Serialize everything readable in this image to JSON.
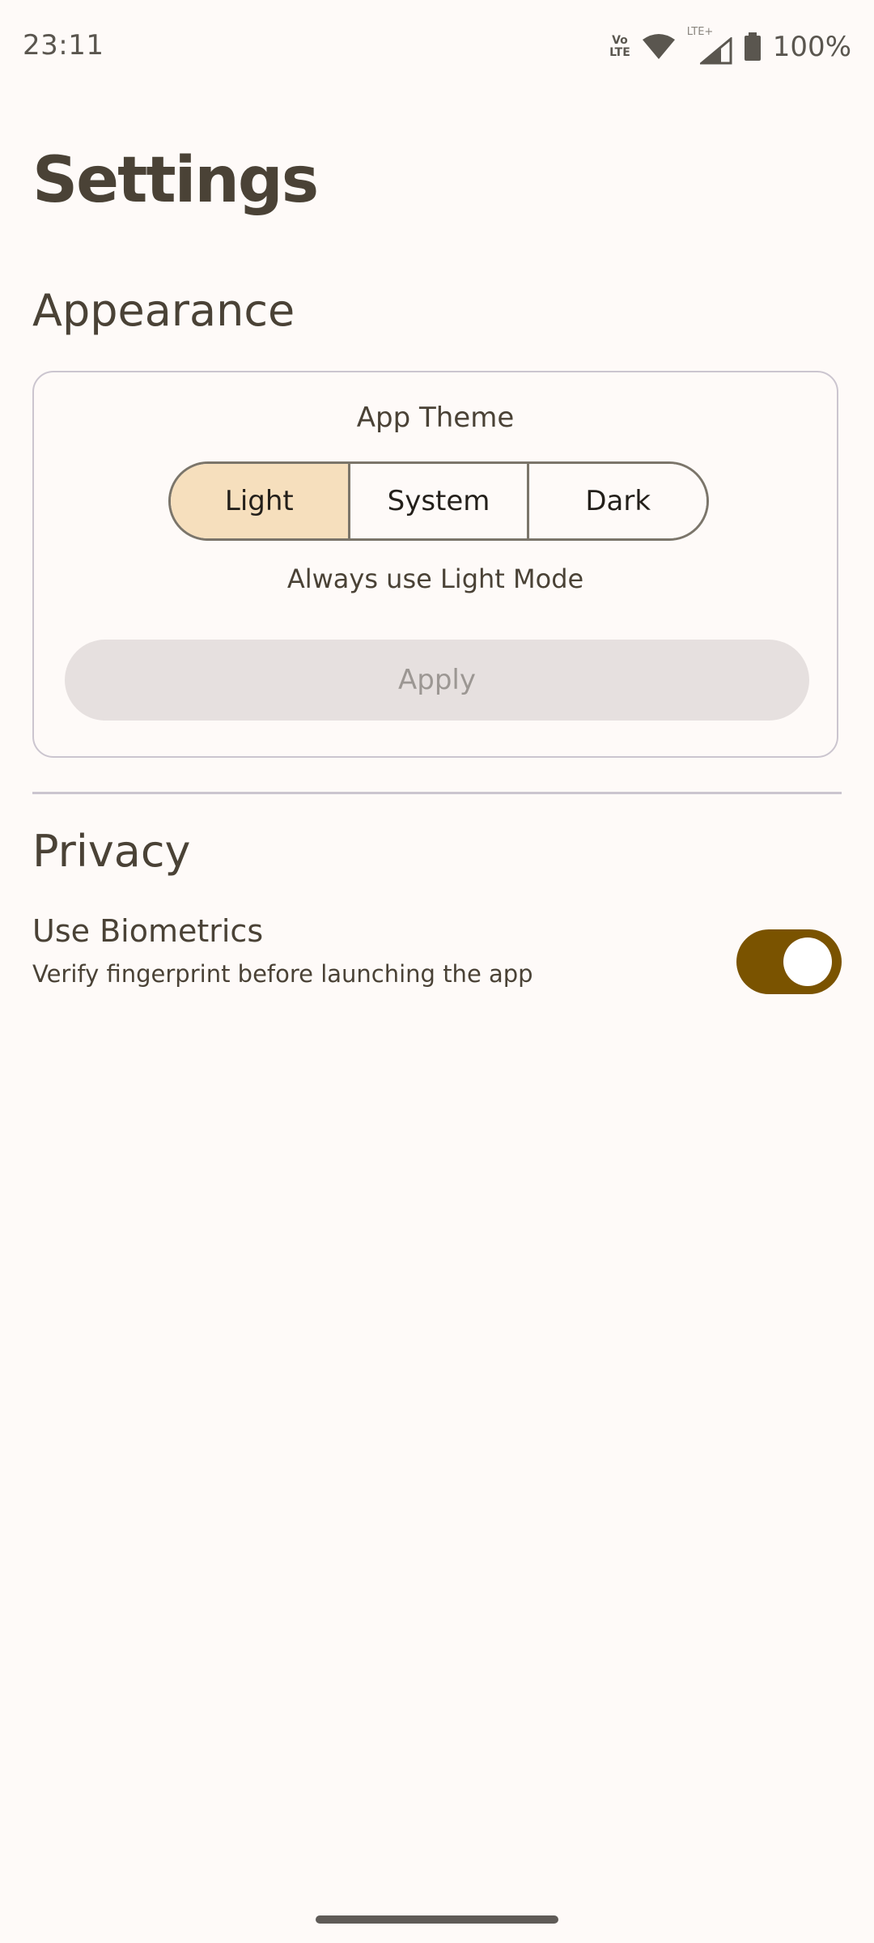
{
  "status_bar": {
    "time": "23:11",
    "volte_top": "Vo",
    "volte_bottom": "LTE",
    "lte_label": "LTE+",
    "battery": "100%",
    "icons": [
      "volte-icon",
      "wifi-icon",
      "signal-icon",
      "battery-icon"
    ]
  },
  "page": {
    "title": "Settings"
  },
  "appearance": {
    "title": "Appearance",
    "card_label": "App Theme",
    "options": [
      "Light",
      "System",
      "Dark"
    ],
    "selected": "Light",
    "hint": "Always use Light Mode",
    "apply_label": "Apply"
  },
  "privacy": {
    "title": "Privacy",
    "biometrics_title": "Use Biometrics",
    "biometrics_desc": "Verify fingerprint before launching the app",
    "biometrics_enabled": true
  },
  "colors": {
    "background": "#fefaf8",
    "text": "#4a4236",
    "selected_segment": "#f6dfbd",
    "toggle_on": "#7a5300",
    "apply_disabled_bg": "#e6e0df",
    "apply_disabled_text": "#9c9793"
  }
}
